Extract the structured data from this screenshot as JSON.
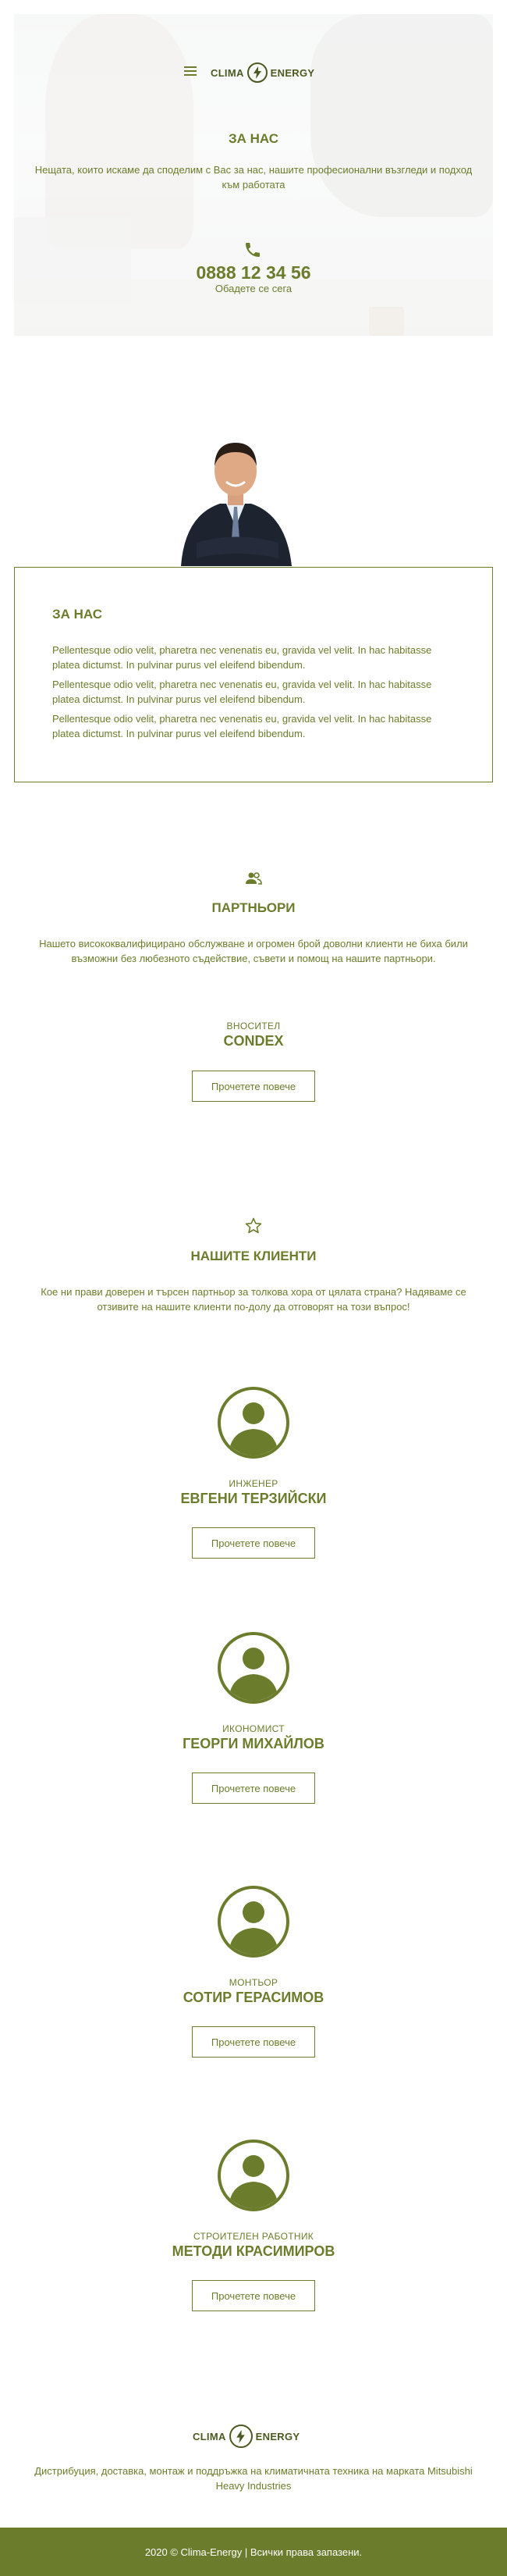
{
  "header": {
    "logo_left": "CLIMA",
    "logo_right": "ENERGY",
    "title": "ЗА НАС",
    "subtitle": "Нещата, които искаме да споделим с Вас за нас, нашите професионални възгледи и подход към работата",
    "phone": "0888 12 34 56",
    "call_text": "Обадете се сега"
  },
  "about": {
    "title": "ЗА НАС",
    "paragraphs": [
      "Pellentesque odio velit, pharetra nec venenatis eu, gravida vel velit. In hac habitasse platea dictumst. In pulvinar purus vel eleifend bibendum.",
      "Pellentesque odio velit, pharetra nec venenatis eu, gravida vel velit. In hac habitasse platea dictumst. In pulvinar purus vel eleifend bibendum.",
      "Pellentesque odio velit, pharetra nec venenatis eu, gravida vel velit. In hac habitasse platea dictumst. In pulvinar purus vel eleifend bibendum."
    ]
  },
  "partners": {
    "title": "ПАРТНЬОРИ",
    "description": "Нашето висококвалифицирано обслужване и огромен брой доволни клиенти не биха били възможни без любезното съдействие, съвети и помощ на нашите партньори.",
    "items": [
      {
        "role": "ВНОСИТЕЛ",
        "name": "CONDEX",
        "button": "Прочетете повече"
      }
    ]
  },
  "clients": {
    "title": "НАШИТЕ КЛИЕНТИ",
    "description": "Кое ни прави доверен и търсен партньор за толкова хора от цялата страна? Надяваме се отзивите на нашите клиенти по-долу да отговорят на този въпрос!",
    "items": [
      {
        "role": "ИНЖЕНЕР",
        "name": "ЕВГЕНИ ТЕРЗИЙСКИ",
        "button": "Прочетете повече"
      },
      {
        "role": "ИКОНОМИСТ",
        "name": "ГЕОРГИ МИХАЙЛОВ",
        "button": "Прочетете повече"
      },
      {
        "role": "МОНТЬОР",
        "name": "СОТИР ГЕРАСИМОВ",
        "button": "Прочетете повече"
      },
      {
        "role": "СТРОИТЕЛЕН РАБОТНИК",
        "name": "МЕТОДИ КРАСИМИРОВ",
        "button": "Прочетете повече"
      }
    ]
  },
  "footer": {
    "logo_left": "CLIMA",
    "logo_right": "ENERGY",
    "text": "Дистрибуция, доставка, монтаж и поддръжка на климатичната техника на марката Mitsubishi Heavy Industries",
    "copyright": "2020 © Clima-Energy | Всички права запазени."
  },
  "colors": {
    "accent": "#6b7d2c",
    "footer_bg": "#6b7d2c"
  }
}
